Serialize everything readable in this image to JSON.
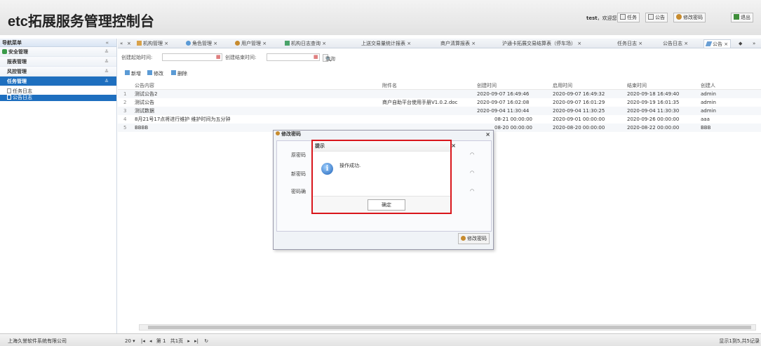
{
  "app": {
    "title": "etc拓展服务管理控制台"
  },
  "header": {
    "user": "test",
    "welcome": "，欢迎您!",
    "task": "任务",
    "notice": "公告",
    "change_pwd": "修改密码",
    "logout": "退出"
  },
  "sidebar": {
    "title": "导航菜单",
    "collapse": "«",
    "items": [
      {
        "label": "安全管理"
      },
      {
        "label": "报表管理"
      },
      {
        "label": "风控管理"
      },
      {
        "label": "任务管理"
      }
    ],
    "subitems": [
      {
        "label": "任务日志"
      },
      {
        "label": "公告日志"
      }
    ]
  },
  "tabs": {
    "nav_left": "«",
    "nav_right": "»",
    "items": [
      {
        "label": "机构管理"
      },
      {
        "label": "角色管理"
      },
      {
        "label": "用户管理"
      },
      {
        "label": "机构日志查询"
      },
      {
        "label": "上送交易量统计报表"
      },
      {
        "label": "商户清算报表"
      },
      {
        "label": "沪通卡拓展交易结算表（停车场）"
      },
      {
        "label": "任务日志"
      },
      {
        "label": "公告日志"
      },
      {
        "label": "公告"
      }
    ]
  },
  "filter": {
    "start_label": "创建起始时间:",
    "end_label": "创建结束时间:",
    "query": "查询"
  },
  "toolbar": {
    "add": "新增",
    "edit": "修改",
    "delete": "删除"
  },
  "table": {
    "headers": [
      "公告内容",
      "附件名",
      "创建时间",
      "启用时间",
      "结束时间",
      "创建人"
    ],
    "rows": [
      {
        "num": "1",
        "content": "测试公告2",
        "file": "",
        "created": "2020-09-07 16:49:46",
        "start": "2020-09-07 16:49:32",
        "end": "2020-09-18 16:49:40",
        "creator": "admin"
      },
      {
        "num": "2",
        "content": "测试公告",
        "file": "商户自助平台使用手册V1.0.2.doc",
        "created": "2020-09-07 16:02:08",
        "start": "2020-09-07 16:01:29",
        "end": "2020-09-19 16:01:35",
        "creator": "admin"
      },
      {
        "num": "3",
        "content": "测试数据",
        "file": "",
        "created": "2020-09-04 11:30:44",
        "start": "2020-09-04 11:30:25",
        "end": "2020-09-04 11:30:30",
        "creator": "admin"
      },
      {
        "num": "4",
        "content": "8月21号17点将进行维护 维护时间为五分钟",
        "file": "",
        "created": "08-21 00:00:00",
        "start": "2020-09-01 00:00:00",
        "end": "2020-09-26 00:00:00",
        "creator": "aaa"
      },
      {
        "num": "5",
        "content": "BBBB",
        "file": "",
        "created": "08-20 00:00:00",
        "start": "2020-08-20 00:00:00",
        "end": "2020-08-22 00:00:00",
        "creator": "BBB"
      }
    ]
  },
  "pwd_dialog": {
    "title": "修改密码",
    "old_label": "原密码",
    "new_label": "新密码",
    "confirm_label": "密码确",
    "submit": "修改密码"
  },
  "alert": {
    "title": "提示",
    "message": "操作成功.",
    "ok": "确定"
  },
  "footer": {
    "copyright": "上海久誉软件系统有限公司",
    "page_size": "20",
    "page_label": "第",
    "page": "1",
    "total_pages": "共1页",
    "info": "显示1到5,共5记录"
  }
}
